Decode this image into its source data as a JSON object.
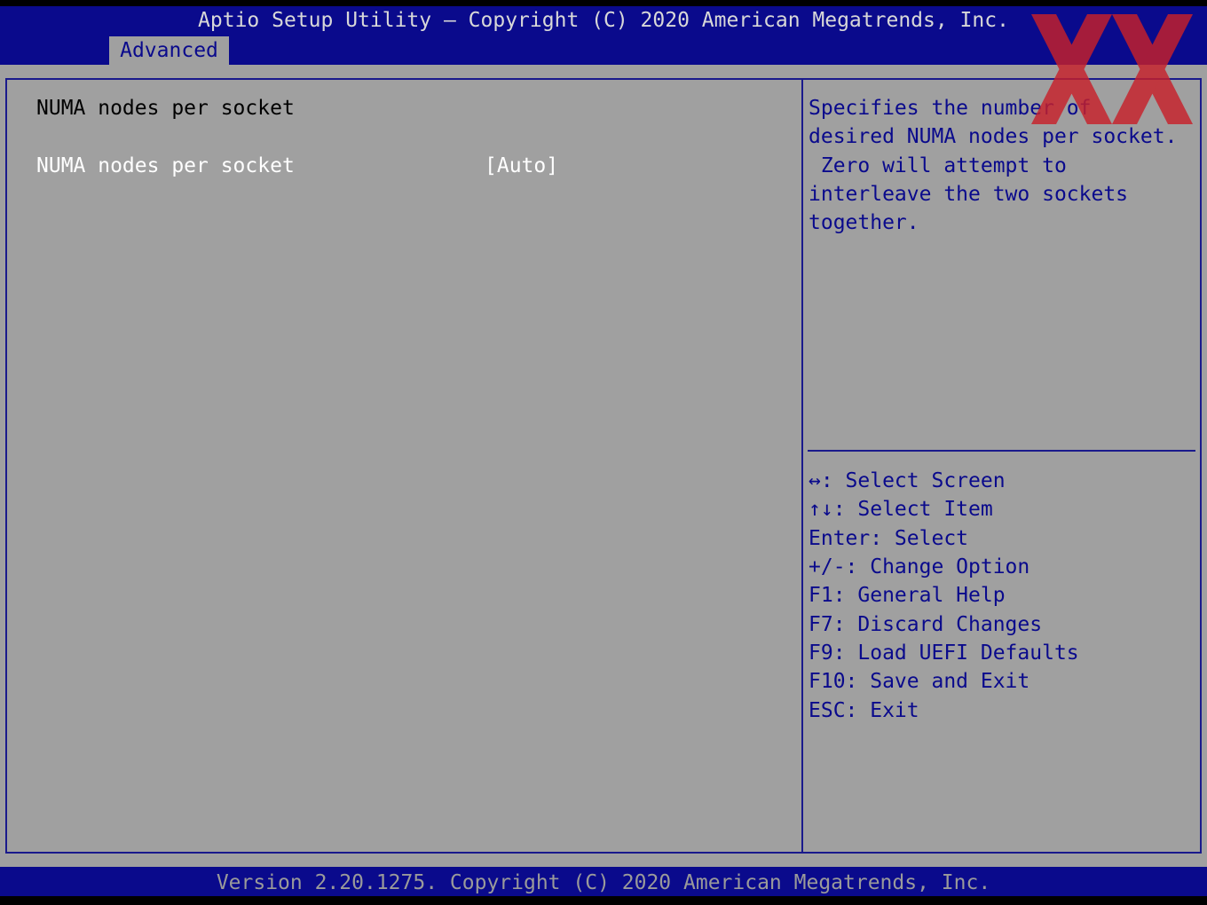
{
  "header": {
    "title": "Aptio Setup Utility – Copyright (C) 2020 American Megatrends, Inc.",
    "active_tab": "Advanced"
  },
  "main": {
    "section_title": "NUMA nodes per socket",
    "setting": {
      "label": "NUMA nodes per socket",
      "value": "[Auto]"
    }
  },
  "help": {
    "lines": [
      "Specifies the number of",
      "desired NUMA nodes per socket.",
      " Zero will attempt to",
      "interleave the two sockets",
      "together."
    ]
  },
  "keys": [
    "↔: Select Screen",
    "↑↓: Select Item",
    "Enter: Select",
    "+/-: Change Option",
    "F1: General Help",
    "F7: Discard Changes",
    "F9: Load UEFI Defaults",
    "F10: Save and Exit",
    "ESC: Exit"
  ],
  "footer": {
    "version": "Version 2.20.1275. Copyright (C) 2020 American Megatrends, Inc."
  },
  "colors": {
    "bar_blue": "#0a0a8c",
    "panel_gray": "#a0a0a0",
    "watermark_red": "#c8202a"
  },
  "watermark": {
    "icon": "xx-logo-watermark",
    "text": "XX"
  }
}
